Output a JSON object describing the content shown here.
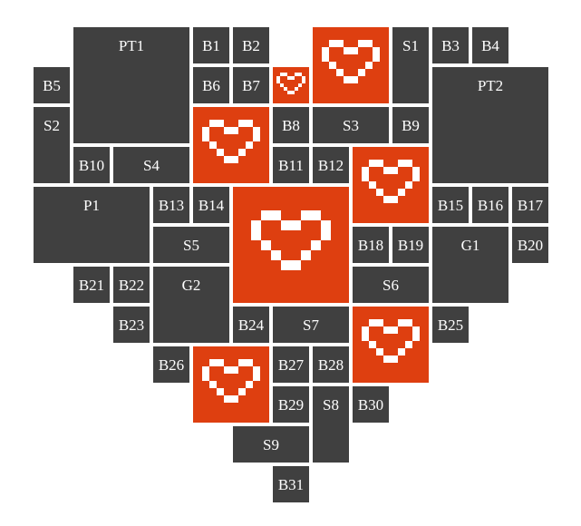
{
  "colors": {
    "background": "#ffffff",
    "tile": "#404040",
    "heart_tile": "#de3f10",
    "heart_pixel": "#ffffff",
    "label": "#ffffff"
  },
  "tiles": {
    "pt1": "PT1",
    "b1": "B1",
    "b2": "B2",
    "s1": "S1",
    "b3": "B3",
    "b4": "B4",
    "b5": "B5",
    "b6": "B6",
    "b7": "B7",
    "pt2": "PT2",
    "s2": "S2",
    "b8": "B8",
    "s3": "S3",
    "b9": "B9",
    "b10": "B10",
    "s4": "S4",
    "b11": "B11",
    "b12": "B12",
    "p1": "P1",
    "b13": "B13",
    "b14": "B14",
    "b15": "B15",
    "b16": "B16",
    "b17": "B17",
    "s5": "S5",
    "b18": "B18",
    "b19": "B19",
    "g1": "G1",
    "b20": "B20",
    "b21": "B21",
    "b22": "B22",
    "g2": "G2",
    "s6": "S6",
    "b23": "B23",
    "b24": "B24",
    "s7": "S7",
    "b25": "B25",
    "b26": "B26",
    "b27": "B27",
    "b28": "B28",
    "b29": "B29",
    "s8": "S8",
    "b30": "B30",
    "s9": "S9",
    "b31": "B31"
  },
  "heart_icons": [
    "heart-pixel-icon",
    "heart-pixel-icon",
    "heart-pixel-icon",
    "heart-pixel-icon",
    "heart-pixel-icon",
    "heart-pixel-icon"
  ]
}
